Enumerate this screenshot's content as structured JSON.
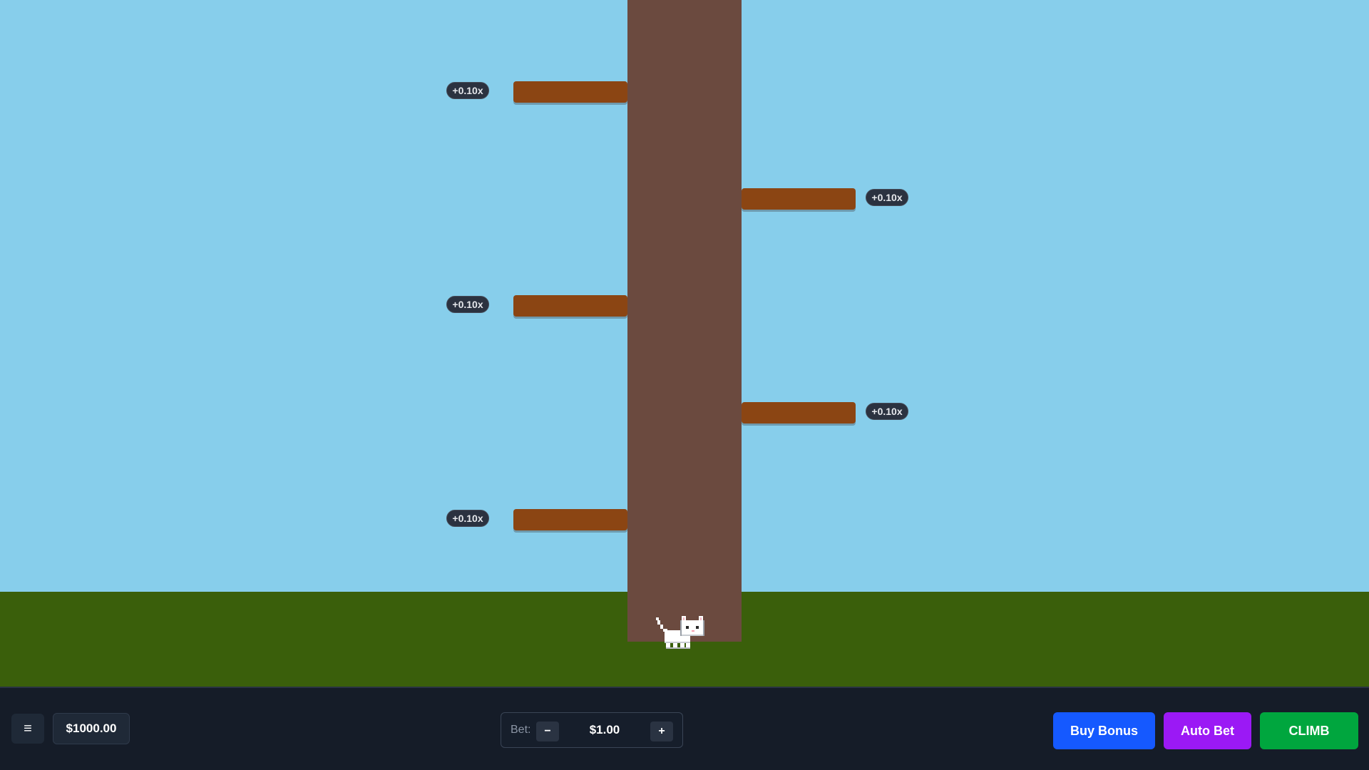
{
  "colors": {
    "sky": "#87ceeb",
    "ground": "#3a5f0b",
    "trunk": "#6b4a3f",
    "branch": "#8b4513",
    "badge": "#2b3240",
    "bottom_bar": "#151c28",
    "buy_bonus": "#1559ff",
    "auto_bet": "#9b19f5",
    "climb": "#00a63e"
  },
  "branches": [
    {
      "side": "left",
      "multiplier": "+0.10x"
    },
    {
      "side": "right",
      "multiplier": "+0.10x"
    },
    {
      "side": "left",
      "multiplier": "+0.10x"
    },
    {
      "side": "right",
      "multiplier": "+0.10x"
    },
    {
      "side": "left",
      "multiplier": "+0.10x"
    }
  ],
  "player": {
    "icon": "cat-icon"
  },
  "bottom_bar": {
    "menu_icon": "≡",
    "balance": "$1000.00",
    "bet": {
      "label": "Bet:",
      "minus": "−",
      "amount": "$1.00",
      "plus": "+"
    },
    "buttons": {
      "buy_bonus": "Buy Bonus",
      "auto_bet": "Auto Bet",
      "climb": "CLIMB"
    }
  }
}
